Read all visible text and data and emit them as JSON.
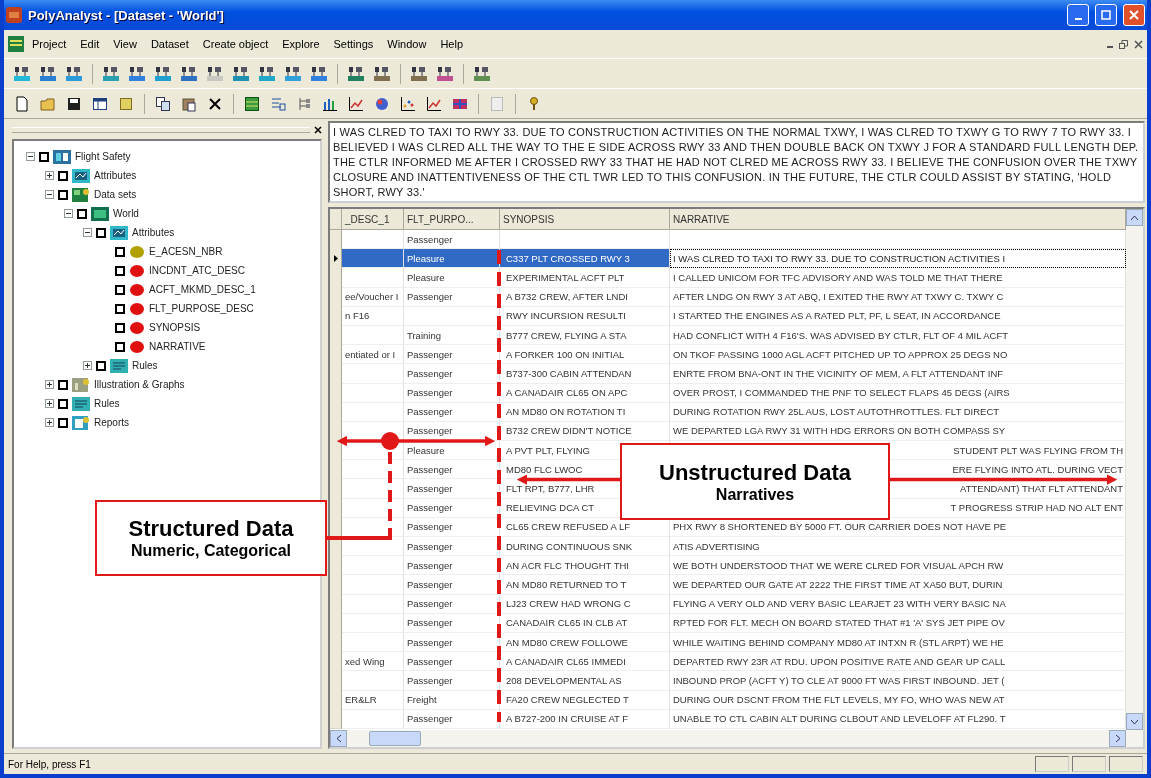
{
  "window": {
    "title": "PolyAnalyst - [Dataset - 'World']"
  },
  "menu": [
    "Project",
    "Edit",
    "View",
    "Dataset",
    "Create object",
    "Explore",
    "Settings",
    "Window",
    "Help"
  ],
  "tree": [
    {
      "label": "Flight Safety",
      "kind": "project",
      "checked": false,
      "expanded": true,
      "children": [
        {
          "label": "Attributes",
          "kind": "attributes",
          "checked": false,
          "expanded": false
        },
        {
          "label": "Data sets",
          "kind": "datasets",
          "checked": false,
          "expanded": true,
          "children": [
            {
              "label": "World",
              "kind": "dataset",
              "checked": false,
              "expanded": true,
              "children": [
                {
                  "label": "Attributes",
                  "kind": "attributes",
                  "checked": false,
                  "expanded": true,
                  "children": [
                    {
                      "label": "E_ACESN_NBR",
                      "kind": "attribute",
                      "checked": false,
                      "color": "#b0a000"
                    },
                    {
                      "label": "INCDNT_ATC_DESC",
                      "kind": "attribute",
                      "checked": false,
                      "color": "#e01010"
                    },
                    {
                      "label": "ACFT_MKMD_DESC_1",
                      "kind": "attribute",
                      "checked": false,
                      "color": "#e01010"
                    },
                    {
                      "label": "FLT_PURPOSE_DESC",
                      "kind": "attribute",
                      "checked": false,
                      "color": "#e01010"
                    },
                    {
                      "label": "SYNOPSIS",
                      "kind": "attribute",
                      "checked": false,
                      "color": "#e01010"
                    },
                    {
                      "label": "NARRATIVE",
                      "kind": "attribute",
                      "checked": false,
                      "color": "#e01010"
                    }
                  ]
                },
                {
                  "label": "Rules",
                  "kind": "rules",
                  "checked": false,
                  "expanded": false
                }
              ]
            }
          ]
        },
        {
          "label": "Illustration & Graphs",
          "kind": "graphs",
          "checked": false,
          "expanded": false
        },
        {
          "label": "Rules",
          "kind": "rules",
          "checked": false,
          "expanded": false
        },
        {
          "label": "Reports",
          "kind": "reports",
          "checked": false,
          "expanded": false
        }
      ]
    }
  ],
  "detail_text": "I WAS CLRED TO TAXI TO RWY 33. DUE TO CONSTRUCTION ACTIVITIES ON THE NORMAL TXWY, I WAS CLRED TO TXWY G TO RWY 7 TO RWY 33. I BELIEVED I WAS CLRED ALL THE WAY TO THE E SIDE ACROSS RWY 33 AND THEN DOUBLE BACK ON TXWY J FOR A STANDARD FULL LENGTH DEP. THE CTLR INFORMED ME AFTER I CROSSED RWY 33 THAT HE HAD NOT CLRED ME ACROSS RWY 33. I BELIEVE THE CONFUSION OVER THE TXWY CLOSURE AND INATTENTIVENESS OF THE CTL TWR LED TO THIS CONFUSION. IN THE FUTURE, THE CTLR COULD ASSIST BY STATING, 'HOLD SHORT, RWY 33.'",
  "table": {
    "columns": [
      "_DESC_1",
      "FLT_PURPO...",
      "SYNOPSIS",
      "NARRATIVE"
    ],
    "rows": [
      {
        "flt_purpose": "Passenger",
        "selected": false
      },
      {
        "desc_1": "",
        "flt_purpose": "Pleasure",
        "synopsis": "C337 PLT CROSSED RWY 3",
        "narrative": "I WAS CLRED TO TAXI TO RWY 33. DUE TO CONSTRUCTION ACTIVITIES I",
        "selected": true,
        "overlapped": false
      },
      {
        "desc_1": "",
        "flt_purpose": "Pleasure",
        "synopsis": "EXPERIMENTAL ACFT PLT",
        "narrative": "I CALLED UNICOM FOR TFC ADVISORY AND WAS TOLD ME THAT THERE",
        "selected": false,
        "overlapped": false
      },
      {
        "desc_1": "ee/Voucher I",
        "flt_purpose": "Passenger",
        "synopsis": "A B732 CREW, AFTER LNDI",
        "narrative": "AFTER LNDG ON RWY 3 AT ABQ, I EXITED THE RWY AT TXWY C. TXWY C",
        "selected": false,
        "overlapped": false
      },
      {
        "desc_1": "n F16",
        "flt_purpose": "",
        "synopsis": "RWY INCURSION RESULTI",
        "narrative": "I STARTED THE ENGINES AS A RATED PLT, PF, L SEAT, IN ACCORDANCE",
        "selected": false,
        "overlapped": false
      },
      {
        "desc_1": "",
        "flt_purpose": "Training",
        "synopsis": "B777 CREW, FLYING A STA",
        "narrative": "HAD CONFLICT WITH 4 F16'S. WAS ADVISED BY CTLR, FLT OF 4 MIL ACFT",
        "selected": false,
        "overlapped": false
      },
      {
        "desc_1": "entiated or I",
        "flt_purpose": "Passenger",
        "synopsis": "A FORKER 100 ON INITIAL",
        "narrative": "ON TKOF PASSING 1000 AGL ACFT PITCHED UP TO APPROX 25 DEGS NO",
        "selected": false,
        "overlapped": false
      },
      {
        "desc_1": "",
        "flt_purpose": "Passenger",
        "synopsis": "B737-300 CABIN ATTENDAN",
        "narrative": "ENRTE FROM BNA-ONT IN THE VICINITY OF MEM, A FLT ATTENDANT INF",
        "selected": false,
        "overlapped": false
      },
      {
        "desc_1": "",
        "flt_purpose": "Passenger",
        "synopsis": "A CANADAIR CL65 ON APC",
        "narrative": "OVER PROST, I COMMANDED THE PNF TO SELECT FLAPS 45 DEGS (AIRS",
        "selected": false,
        "overlapped": false
      },
      {
        "desc_1": "",
        "flt_purpose": "Passenger",
        "synopsis": "AN MD80 ON ROTATION TI",
        "narrative": "DURING ROTATION RWY 25L AUS, LOST AUTOTHROTTLES. FLT DIRECT",
        "selected": false,
        "overlapped": false
      },
      {
        "desc_1": "",
        "flt_purpose": "Passenger",
        "synopsis": "B732 CREW DIDN'T NOTICE",
        "narrative": "WE DEPARTED LGA RWY 31 WITH HDG ERRORS ON BOTH COMPASS SY",
        "selected": false,
        "overlapped": false
      },
      {
        "desc_1": "",
        "flt_purpose": "Pleasure",
        "synopsis": "A PVT PLT, FLYING",
        "narrative": "STUDENT PLT WAS FLYING FROM TH",
        "selected": false,
        "overlapped": true
      },
      {
        "desc_1": "",
        "flt_purpose": "Passenger",
        "synopsis": "MD80 FLC LWOC",
        "narrative": "ERE FLYING INTO ATL. DURING VECT",
        "selected": false,
        "overlapped": true
      },
      {
        "desc_1": "",
        "flt_purpose": "Passenger",
        "synopsis": "FLT RPT, B777, LHR",
        "narrative": "ATTENDANT) THAT FLT ATTENDANT",
        "selected": false,
        "overlapped": true
      },
      {
        "desc_1": "",
        "flt_purpose": "Passenger",
        "synopsis": "RELIEVING DCA CT",
        "narrative": "T PROGRESS STRIP HAD NO ALT ENT",
        "selected": false,
        "overlapped": true
      },
      {
        "desc_1": "",
        "flt_purpose": "Passenger",
        "synopsis": "CL65 CREW REFUSED A LF",
        "narrative": "PHX RWY 8 SHORTENED BY 5000 FT. OUR CARRIER DOES NOT HAVE PE",
        "selected": false,
        "overlapped": false
      },
      {
        "desc_1": "",
        "flt_purpose": "Passenger",
        "synopsis": "DURING CONTINUOUS SNK",
        "narrative": "ATIS ADVERTISING",
        "selected": false,
        "overlapped": false
      },
      {
        "desc_1": "",
        "flt_purpose": "Passenger",
        "synopsis": "AN ACR FLC THOUGHT THI",
        "narrative": "WE BOTH UNDERSTOOD THAT WE WERE CLRED FOR VISUAL APCH RW",
        "selected": false,
        "overlapped": false
      },
      {
        "desc_1": "",
        "flt_purpose": "Passenger",
        "synopsis": "AN MD80 RETURNED TO T",
        "narrative": "WE DEPARTED OUR GATE AT 2222 THE FIRST TIME AT XA50 BUT, DURIN",
        "selected": false,
        "overlapped": false
      },
      {
        "desc_1": "",
        "flt_purpose": "Passenger",
        "synopsis": "LJ23 CREW HAD WRONG C",
        "narrative": "FLYING A VERY OLD AND VERY BASIC LEARJET 23 WITH VERY BASIC NA",
        "selected": false,
        "overlapped": false
      },
      {
        "desc_1": "",
        "flt_purpose": "Passenger",
        "synopsis": "CANADAIR CL65 IN CLB AT",
        "narrative": "RPTED FOR FLT. MECH ON BOARD STATED THAT #1 'A' SYS JET PIPE OV",
        "selected": false,
        "overlapped": false
      },
      {
        "desc_1": "",
        "flt_purpose": "Passenger",
        "synopsis": "AN MD80 CREW FOLLOWE",
        "narrative": "WHILE WAITING BEHIND COMPANY MD80 AT INTXN R (STL ARPT) WE HE",
        "selected": false,
        "overlapped": false
      },
      {
        "desc_1": "xed Wing",
        "flt_purpose": "Passenger",
        "synopsis": "A CANADAIR CL65 IMMEDI",
        "narrative": "DEPARTED RWY 23R AT RDU. UPON POSITIVE RATE AND GEAR UP CALL",
        "selected": false,
        "overlapped": false
      },
      {
        "desc_1": "",
        "flt_purpose": "Passenger",
        "synopsis": "208 DEVELOPMENTAL AS",
        "narrative": "INBOUND PROP (ACFT Y) TO CLE AT 9000 FT WAS FIRST INBOUND. JET (",
        "selected": false,
        "overlapped": false
      },
      {
        "desc_1": "ER&LR",
        "flt_purpose": "Freight",
        "synopsis": "FA20 CREW NEGLECTED T",
        "narrative": "DURING OUR DSCNT FROM THE FLT LEVELS, MY FO, WHO WAS NEW AT",
        "selected": false,
        "overlapped": false
      },
      {
        "desc_1": "",
        "flt_purpose": "Passenger",
        "synopsis": "A B727-200 IN CRUISE AT F",
        "narrative": "UNABLE TO CTL CABIN ALT DURING CLBOUT AND LEVELOFF AT FL290. T",
        "selected": false,
        "overlapped": false
      }
    ]
  },
  "annotations": [
    {
      "title": "Structured Data",
      "subtitle": "Numeric, Categorical"
    },
    {
      "title": "Unstructured Data",
      "subtitle": "Narratives"
    }
  ],
  "status_bar": "For Help, press F1"
}
